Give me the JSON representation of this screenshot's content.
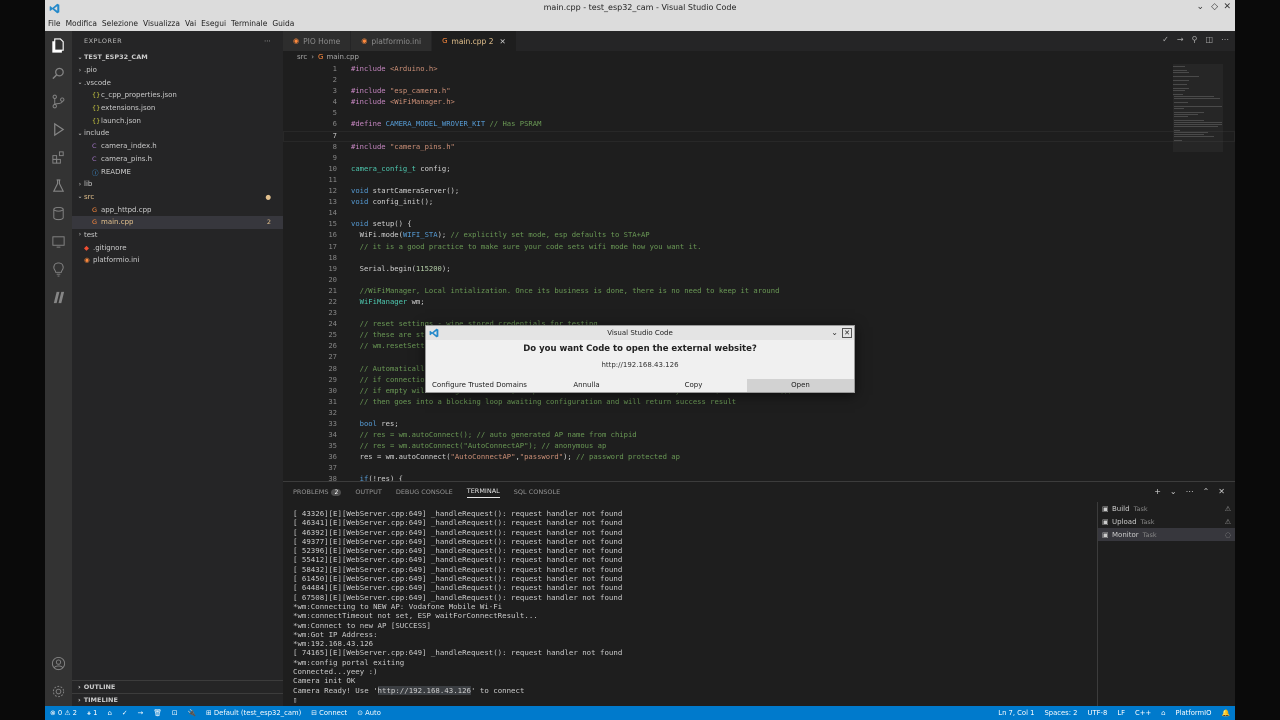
{
  "window": {
    "title": "main.cpp - test_esp32_cam - Visual Studio Code",
    "controls": [
      "chevron-down",
      "diamond",
      "close"
    ]
  },
  "menu": [
    "File",
    "Modifica",
    "Selezione",
    "Visualizza",
    "Vai",
    "Esegui",
    "Terminale",
    "Guida"
  ],
  "sidebar": {
    "header": "EXPLORER",
    "root": "TEST_ESP32_CAM",
    "items": [
      {
        "label": ".pio",
        "type": "folder",
        "depth": 1,
        "open": false
      },
      {
        "label": ".vscode",
        "type": "folder",
        "depth": 1,
        "open": true
      },
      {
        "label": "c_cpp_properties.json",
        "type": "json",
        "depth": 2
      },
      {
        "label": "extensions.json",
        "type": "json",
        "depth": 2
      },
      {
        "label": "launch.json",
        "type": "json",
        "depth": 2
      },
      {
        "label": "include",
        "type": "folder",
        "depth": 1,
        "open": true
      },
      {
        "label": "camera_index.h",
        "type": "c",
        "depth": 2
      },
      {
        "label": "camera_pins.h",
        "type": "c",
        "depth": 2
      },
      {
        "label": "README",
        "type": "info",
        "depth": 2
      },
      {
        "label": "lib",
        "type": "folder",
        "depth": 1,
        "open": false
      },
      {
        "label": "src",
        "type": "folder",
        "depth": 1,
        "open": true,
        "modified": true,
        "badge": "●"
      },
      {
        "label": "app_httpd.cpp",
        "type": "cpp",
        "depth": 2
      },
      {
        "label": "main.cpp",
        "type": "cpp",
        "depth": 2,
        "selected": true,
        "modified": true,
        "badge": "2"
      },
      {
        "label": "test",
        "type": "folder",
        "depth": 1,
        "open": false
      },
      {
        "label": ".gitignore",
        "type": "git",
        "depth": 1
      },
      {
        "label": "platformio.ini",
        "type": "pio",
        "depth": 1
      }
    ],
    "outline": "OUTLINE",
    "timeline": "TIMELINE"
  },
  "tabs": [
    {
      "label": "PIO Home",
      "icon": "pio-icon"
    },
    {
      "label": "platformio.ini",
      "icon": "pio-icon"
    },
    {
      "label": "main.cpp 2",
      "icon": "cpp-icon",
      "active": true
    }
  ],
  "breadcrumb": {
    "folder": "src",
    "file": "main.cpp"
  },
  "code": [
    {
      "n": "1",
      "t": "#include <Arduino.h>"
    },
    {
      "n": "2",
      "t": ""
    },
    {
      "n": "3",
      "t": "#include \"esp_camera.h\""
    },
    {
      "n": "4",
      "t": "#include <WiFiManager.h>"
    },
    {
      "n": "5",
      "t": ""
    },
    {
      "n": "6",
      "t": "#define CAMERA_MODEL_WROVER_KIT // Has PSRAM"
    },
    {
      "n": "7",
      "t": "",
      "current": true
    },
    {
      "n": "8",
      "t": "#include \"camera_pins.h\""
    },
    {
      "n": "9",
      "t": ""
    },
    {
      "n": "10",
      "t": "camera_config_t config;"
    },
    {
      "n": "11",
      "t": ""
    },
    {
      "n": "12",
      "t": "void startCameraServer();"
    },
    {
      "n": "13",
      "t": "void config_init();"
    },
    {
      "n": "14",
      "t": ""
    },
    {
      "n": "15",
      "t": "void setup() {"
    },
    {
      "n": "16",
      "t": "  WiFi.mode(WIFI_STA); // explicitly set mode, esp defaults to STA+AP"
    },
    {
      "n": "17",
      "t": "  // it is a good practice to make sure your code sets wifi mode how you want it."
    },
    {
      "n": "18",
      "t": ""
    },
    {
      "n": "19",
      "t": "  Serial.begin(115200);"
    },
    {
      "n": "20",
      "t": ""
    },
    {
      "n": "21",
      "t": "  //WiFiManager, Local intialization. Once its business is done, there is no need to keep it around"
    },
    {
      "n": "22",
      "t": "  WiFiManager wm;"
    },
    {
      "n": "23",
      "t": ""
    },
    {
      "n": "24",
      "t": "  // reset settings - wipe stored credentials for testing"
    },
    {
      "n": "25",
      "t": "  // these are stored by the esp library"
    },
    {
      "n": "26",
      "t": "  // wm.resetSettings();"
    },
    {
      "n": "27",
      "t": ""
    },
    {
      "n": "28",
      "t": "  // Automatically connect using saved credentials,"
    },
    {
      "n": "29",
      "t": "  // if connection fails, it starts an access point with the specified name ( \"AutoConnectAP\"),"
    },
    {
      "n": "30",
      "t": "  // if empty will auto generate SSID, if password is blank it will be anonymous AP (wm.autoConnect())"
    },
    {
      "n": "31",
      "t": "  // then goes into a blocking loop awaiting configuration and will return success result"
    },
    {
      "n": "32",
      "t": ""
    },
    {
      "n": "33",
      "t": "  bool res;"
    },
    {
      "n": "34",
      "t": "  // res = wm.autoConnect(); // auto generated AP name from chipid"
    },
    {
      "n": "35",
      "t": "  // res = wm.autoConnect(\"AutoConnectAP\"); // anonymous ap"
    },
    {
      "n": "36",
      "t": "  res = wm.autoConnect(\"AutoConnectAP\",\"password\"); // password protected ap"
    },
    {
      "n": "37",
      "t": ""
    },
    {
      "n": "38",
      "t": "  if(!res) {"
    }
  ],
  "panel": {
    "tabs": [
      {
        "label": "PROBLEMS",
        "badge": "2"
      },
      {
        "label": "OUTPUT"
      },
      {
        "label": "DEBUG CONSOLE"
      },
      {
        "label": "TERMINAL",
        "active": true
      },
      {
        "label": "SQL CONSOLE"
      }
    ],
    "terminal": [
      "[ 43326][E][WebServer.cpp:649] _handleRequest(): request handler not found",
      "[ 46341][E][WebServer.cpp:649] _handleRequest(): request handler not found",
      "[ 46392][E][WebServer.cpp:649] _handleRequest(): request handler not found",
      "[ 49377][E][WebServer.cpp:649] _handleRequest(): request handler not found",
      "[ 52396][E][WebServer.cpp:649] _handleRequest(): request handler not found",
      "[ 55412][E][WebServer.cpp:649] _handleRequest(): request handler not found",
      "[ 58432][E][WebServer.cpp:649] _handleRequest(): request handler not found",
      "[ 61450][E][WebServer.cpp:649] _handleRequest(): request handler not found",
      "[ 64484][E][WebServer.cpp:649] _handleRequest(): request handler not found",
      "[ 67508][E][WebServer.cpp:649] _handleRequest(): request handler not found",
      "*wm:Connecting to NEW AP: Vodafone Mobile Wi-Fi",
      "*wm:connectTimeout not set, ESP waitForConnectResult...",
      "*wm:Connect to new AP [SUCCESS]",
      "*wm:Got IP Address:",
      "*wm:192.168.43.126",
      "[ 74165][E][WebServer.cpp:649] _handleRequest(): request handler not found",
      "*wm:config portal exiting",
      "Connected...yeey :)",
      "Camera init OK"
    ],
    "last_line": {
      "prefix": "Camera Ready! Use '",
      "link": "http://192.168.43.126",
      "suffix": "' to connect"
    },
    "cursor": "▯",
    "tasks": [
      {
        "label": "Build",
        "sub": "Task",
        "status": "⚠"
      },
      {
        "label": "Upload",
        "sub": "Task",
        "status": "⚠"
      },
      {
        "label": "Monitor",
        "sub": "Task",
        "status": "◌",
        "selected": true
      }
    ]
  },
  "dialog": {
    "title": "Visual Studio Code",
    "message": "Do you want Code to open the external website?",
    "url": "http://192.168.43.126",
    "buttons": {
      "trusted": "Configure Trusted Domains",
      "cancel": "Annulla",
      "copy": "Copy",
      "open": "Open"
    }
  },
  "status": {
    "left": [
      "⊗ 0 ⚠ 2",
      "⚹ 1",
      "⌂",
      "✓",
      "→",
      "🗑",
      "⊡",
      "🔌",
      "⊞ Default (test_esp32_cam)",
      "⊟ Connect",
      "⊙ Auto"
    ],
    "right": [
      "Ln 7, Col 1",
      "Spaces: 2",
      "UTF-8",
      "LF",
      "C++",
      "⌂",
      "PlatformIO",
      "🔔"
    ]
  },
  "colors": {
    "accent": "#007acc",
    "modified": "#e2c08d",
    "comment": "#6a9955",
    "keyword": "#569cd6",
    "string": "#ce9178",
    "preproc": "#c586c0",
    "type": "#4ec9b0",
    "function": "#dcdcaa",
    "number": "#b5cea8",
    "variable": "#9cdcfe"
  }
}
